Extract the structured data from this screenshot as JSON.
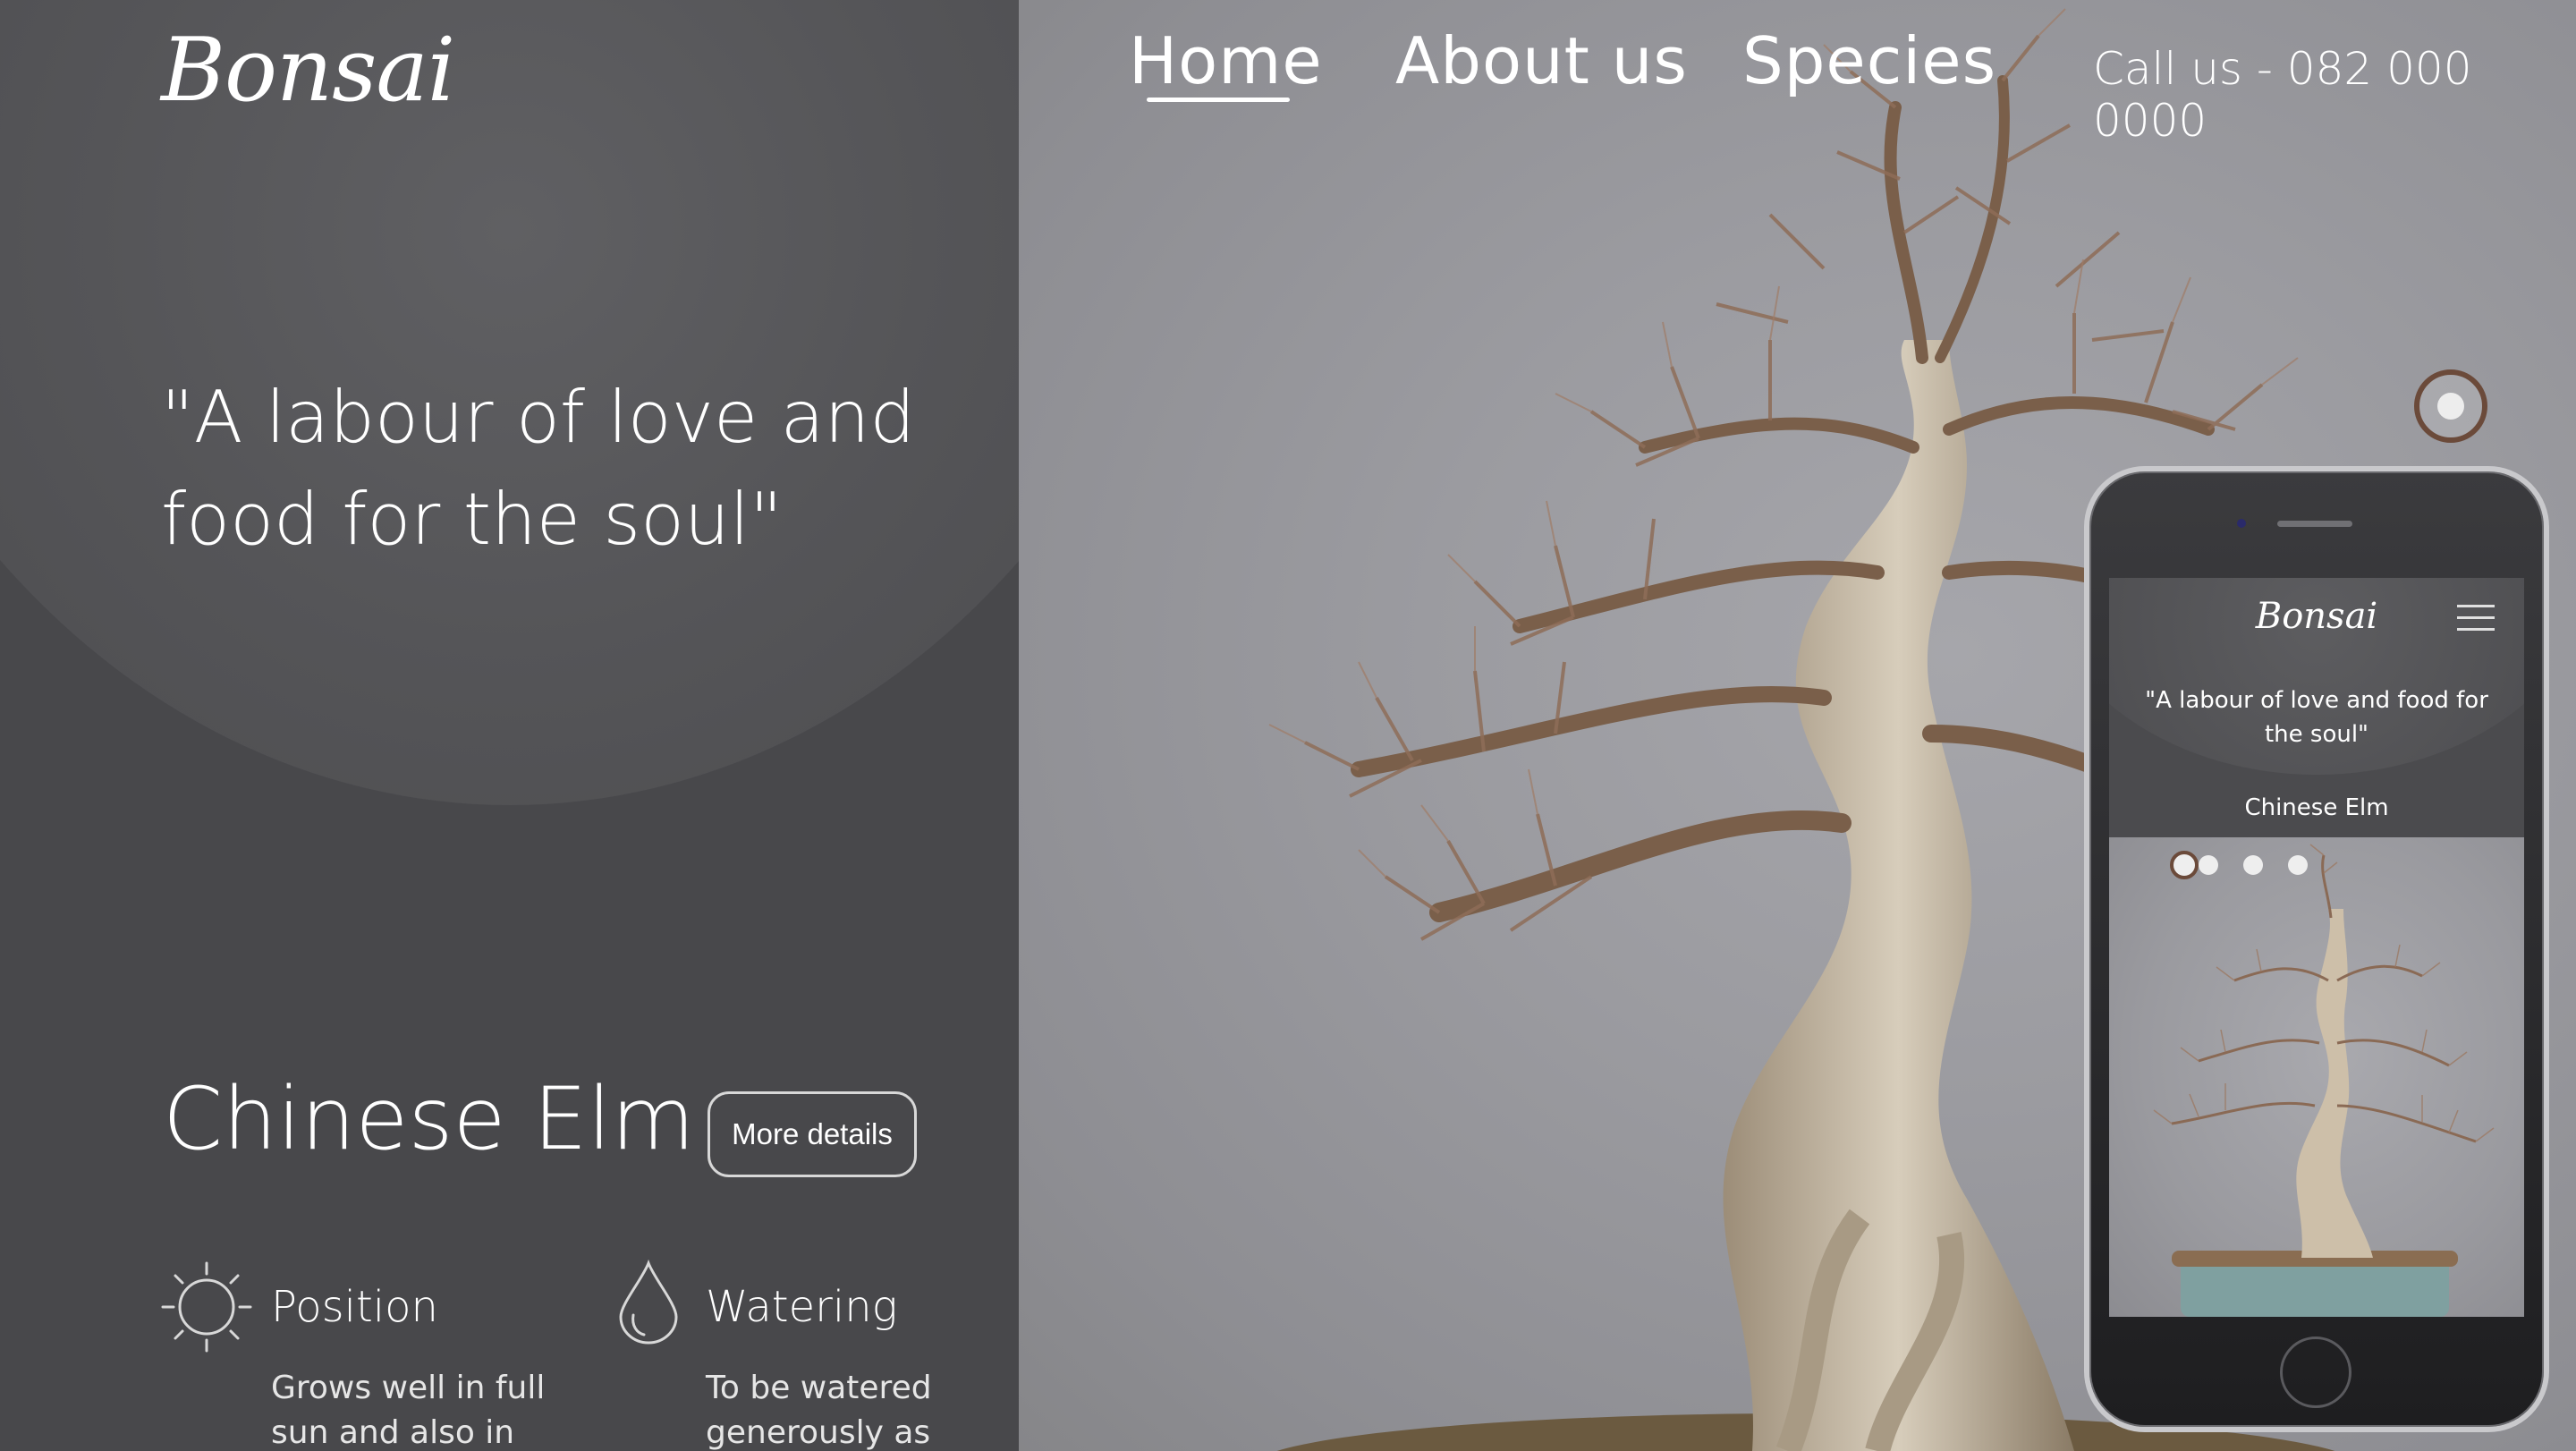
{
  "brand": {
    "name": "Bonsai"
  },
  "nav": {
    "items": [
      {
        "label": "Home",
        "active": true
      },
      {
        "label": "About us",
        "active": false
      },
      {
        "label": "Species",
        "active": false
      }
    ],
    "call": "Call us - 082 000 0000"
  },
  "hero": {
    "quote": "\"A labour of love and food for the soul\""
  },
  "species": {
    "name": "Chinese Elm",
    "details_button": "More details",
    "features": [
      {
        "icon": "sun-icon",
        "label": "Position",
        "text": "Grows well in full sun and also in partial"
      },
      {
        "icon": "water-drop-icon",
        "label": "Watering",
        "text": "To be watered generously as soon"
      }
    ]
  },
  "carousel": {
    "active_index": 0,
    "count": 4
  },
  "mobile": {
    "logo": "Bonsai",
    "quote": "\"A labour of love and food for the soul\"",
    "species": "Chinese Elm",
    "menu_icon": "hamburger-menu-icon"
  },
  "colors": {
    "panel": "#48484b",
    "accent": "#6b4a3a",
    "background": "#9b9ba0"
  }
}
